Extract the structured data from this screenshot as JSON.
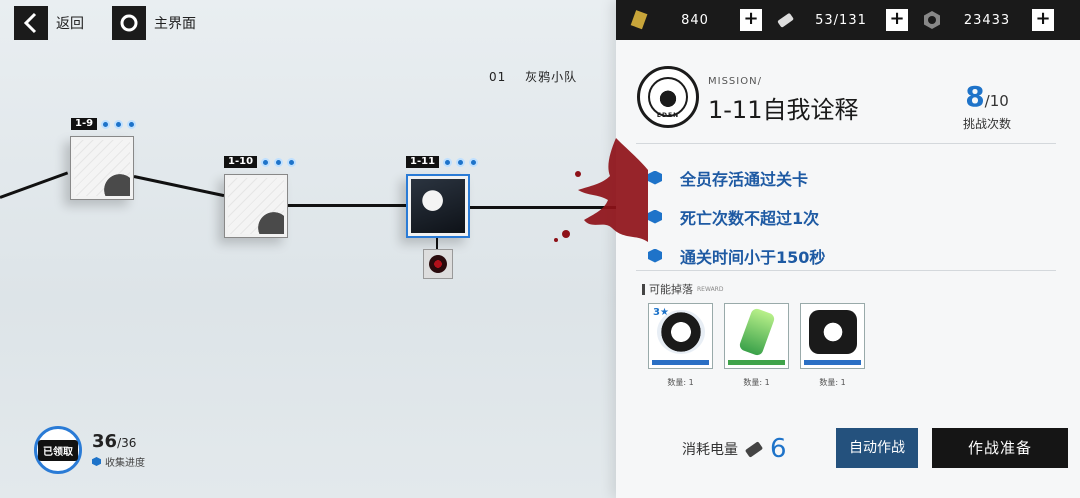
{
  "nav": {
    "back_label": "返回",
    "home_label": "主界面"
  },
  "squad": {
    "number": "01",
    "name": "灰鸦小队"
  },
  "stages": [
    {
      "code": "1-9"
    },
    {
      "code": "1-10"
    },
    {
      "code": "1-11"
    }
  ],
  "collection": {
    "badge": "已领取",
    "current": "36",
    "total": "/36",
    "label": "收集进度"
  },
  "resources": {
    "blackcard": {
      "value": "840",
      "icon": "black-card-icon"
    },
    "energy": {
      "value": "53/131",
      "icon": "battery-icon"
    },
    "coin": {
      "value": "23433",
      "icon": "gear-coin-icon"
    },
    "plus": "+"
  },
  "mission": {
    "emblem_text": "EDEN",
    "tag": "MISSION/",
    "title": "1-11自我诠释",
    "tries_current": "8",
    "tries_total": "/10",
    "tries_label": "挑战次数"
  },
  "conditions": [
    "全员存活通过关卡",
    "死亡次数不超过1次",
    "通关时间小于150秒"
  ],
  "drops": {
    "title": "可能掉落",
    "title_en": "REWARD",
    "items": [
      {
        "star": "3★",
        "qty": "数量: 1"
      },
      {
        "star": "",
        "qty": "数量: 1"
      },
      {
        "star": "",
        "qty": "数量: 1"
      }
    ]
  },
  "cost": {
    "label": "消耗电量",
    "value": "6"
  },
  "buttons": {
    "auto": "自动作战",
    "prepare": "作战准备"
  },
  "colors": {
    "accent": "#1e73c9",
    "dark": "#151515",
    "auto_button": "#24517d"
  }
}
